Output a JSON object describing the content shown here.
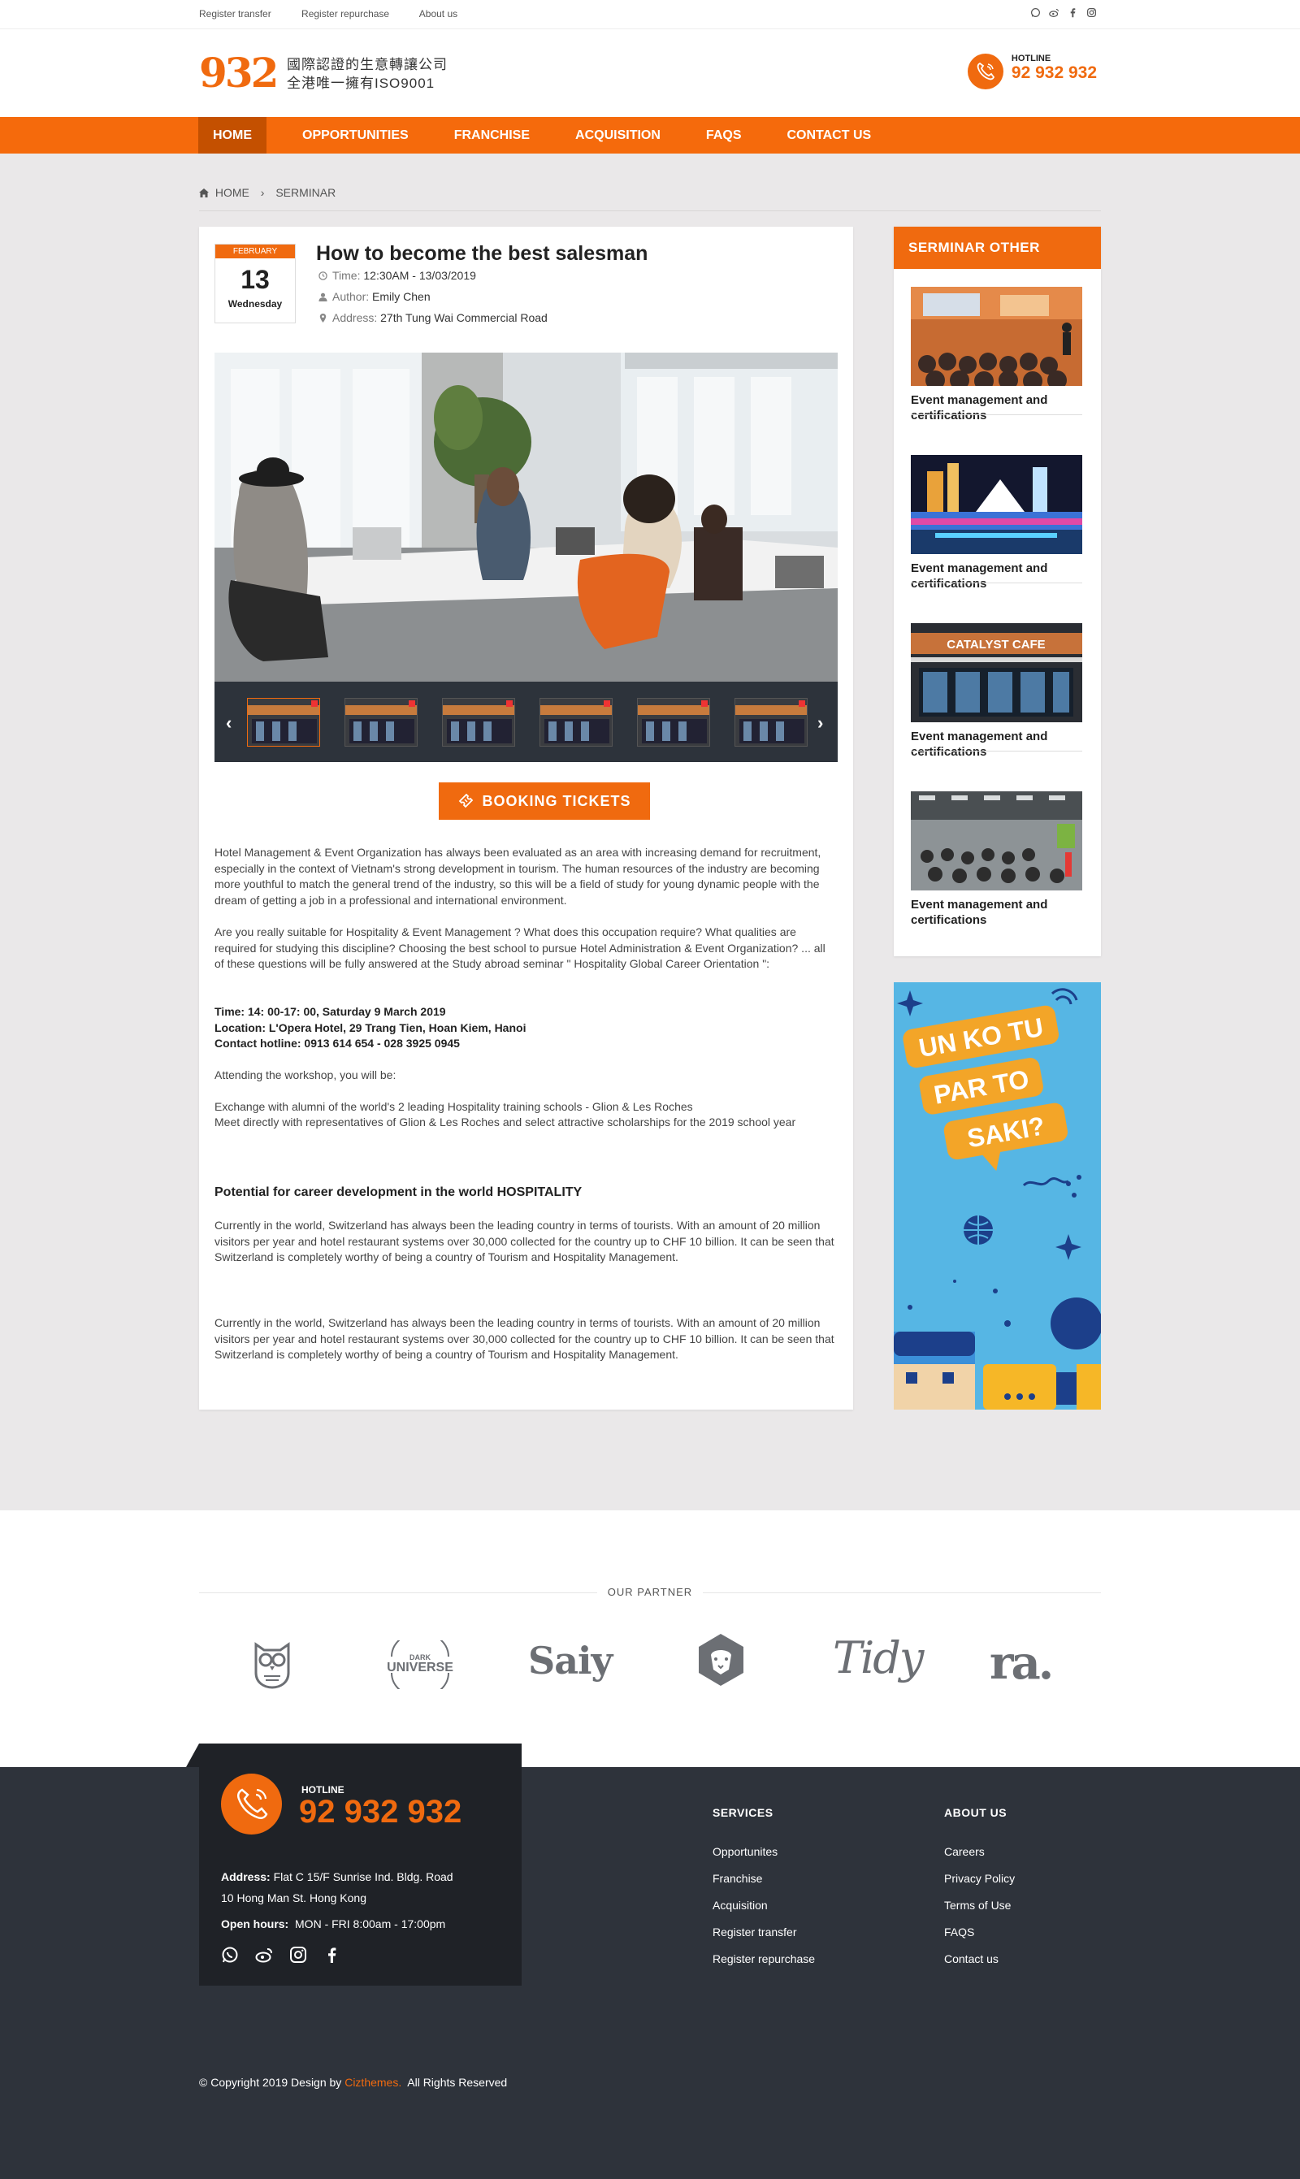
{
  "topbar": {
    "links": [
      "Register transfer",
      "Register repurchase",
      "About us"
    ]
  },
  "header": {
    "logo_number": "932",
    "logo_line1": "國際認證的生意轉讓公司",
    "logo_line2": "全港唯一擁有ISO9001",
    "hotline_label": "HOTLINE",
    "hotline_number": "92 932 932"
  },
  "nav": [
    "HOME",
    "OPPORTUNITIES",
    "FRANCHISE",
    "ACQUISITION",
    "FAQS",
    "CONTACT US"
  ],
  "breadcrumb": {
    "home": "HOME",
    "current": "SERMINAR"
  },
  "event": {
    "month": "FEBRUARY",
    "day": "13",
    "weekday": "Wednesday",
    "title": "How to become the best salesman",
    "time_label": "Time:",
    "time": "12:30AM - 13/03/2019",
    "author_label": "Author:",
    "author": "Emily Chen",
    "address_label": "Address:",
    "address": "27th Tung Wai Commercial  Road",
    "booking": "BOOKING TICKETS"
  },
  "article": {
    "p1": "Hotel Management & Event Organization has always been evaluated as an area with increasing demand for recruitment, especially in the context of Vietnam's strong development in tourism. The human resources of the industry are becoming more youthful to match the general trend of the industry, so this will be a field of study for young dynamic people with the dream of getting a job in a professional and international environment.",
    "p2": "Are you really suitable for  Hospitality & Event Management ? What does this occupation require? What qualities are required for studying this discipline? Choosing the best school to pursue Hotel Administration & Event Organization? ... all of these questions will be fully answered at the Study abroad seminar \" Hospitality Global Career Orientation \":",
    "info_time": "Time:  14: 00-17: 00, Saturday 9 March  2019",
    "info_location": "Location:  L'Opera Hotel, 29 Trang Tien, Hoan Kiem, Hanoi",
    "info_contact": "Contact hotline:   0913 614 654  - 028 3925 0945",
    "p3": "Attending the workshop, you will be:",
    "p4a": "Exchange with alumni of the world's 2 leading Hospitality training schools - Glion & Les Roches",
    "p4b": "Meet directly with representatives of Glion & Les Roches and select attractive scholarships for the 2019 school year",
    "subheading": "Potential for career development in the world HOSPITALITY",
    "p5": "Currently in the world, Switzerland has always been the leading country in terms of tourists. With an amount of 20 million visitors per year and hotel restaurant systems over 30,000 collected for the country up to CHF 10 billion. It can be seen that Switzerland is completely worthy of being a country of Tourism and Hospitality Management.",
    "p6": "Currently in the world, Switzerland has always been the leading country in terms of tourists. With an amount of 20 million visitors per year and hotel restaurant systems over 30,000 collected for the country up to CHF 10 billion. It can be seen that Switzerland is completely worthy of being a country of Tourism and Hospitality Management."
  },
  "sidebar": {
    "title": "SERMINAR OTHER",
    "items": [
      {
        "caption": "Event management and certifications"
      },
      {
        "caption": "Event management and certifications"
      },
      {
        "caption": "Event management and certifications"
      },
      {
        "caption": "Event management and certifications"
      }
    ],
    "ad_text": [
      "UN KO TU",
      "PAR TO",
      "SAKI?"
    ]
  },
  "partners": {
    "title": "OUR PARTNER",
    "logos": [
      "owl-logo",
      "DARK UNIVERSE",
      "Saiy",
      "lion-logo",
      "Tidy",
      "ra."
    ]
  },
  "footer": {
    "hotline_label": "HOTLINE",
    "hotline_number": "92 932 932",
    "address_label": "Address:",
    "address_line1": "Flat C 15/F Sunrise Ind. Bldg.  Road",
    "address_line2": "10 Hong Man St. Hong Kong",
    "hours_label": "Open hours:",
    "hours": "MON - FRI  8:00am - 17:00pm",
    "services_title": "SERVICES",
    "services": [
      "Opportunites",
      "Franchise",
      "Acquisition",
      "Register transfer",
      "Register repurchase"
    ],
    "about_title": "ABOUT US",
    "about": [
      "Careers",
      "Privacy Policy",
      "Terms of Use",
      "FAQS",
      "Contact us"
    ],
    "copyright_pre": "© Copyright 2019 Design by",
    "copyright_link": "Cizthemes.",
    "copyright_post": "All Rights Reserved"
  },
  "colors": {
    "accent": "#f06a0f",
    "footer_bg": "#2e333b",
    "main_bg": "#eae8e9"
  }
}
